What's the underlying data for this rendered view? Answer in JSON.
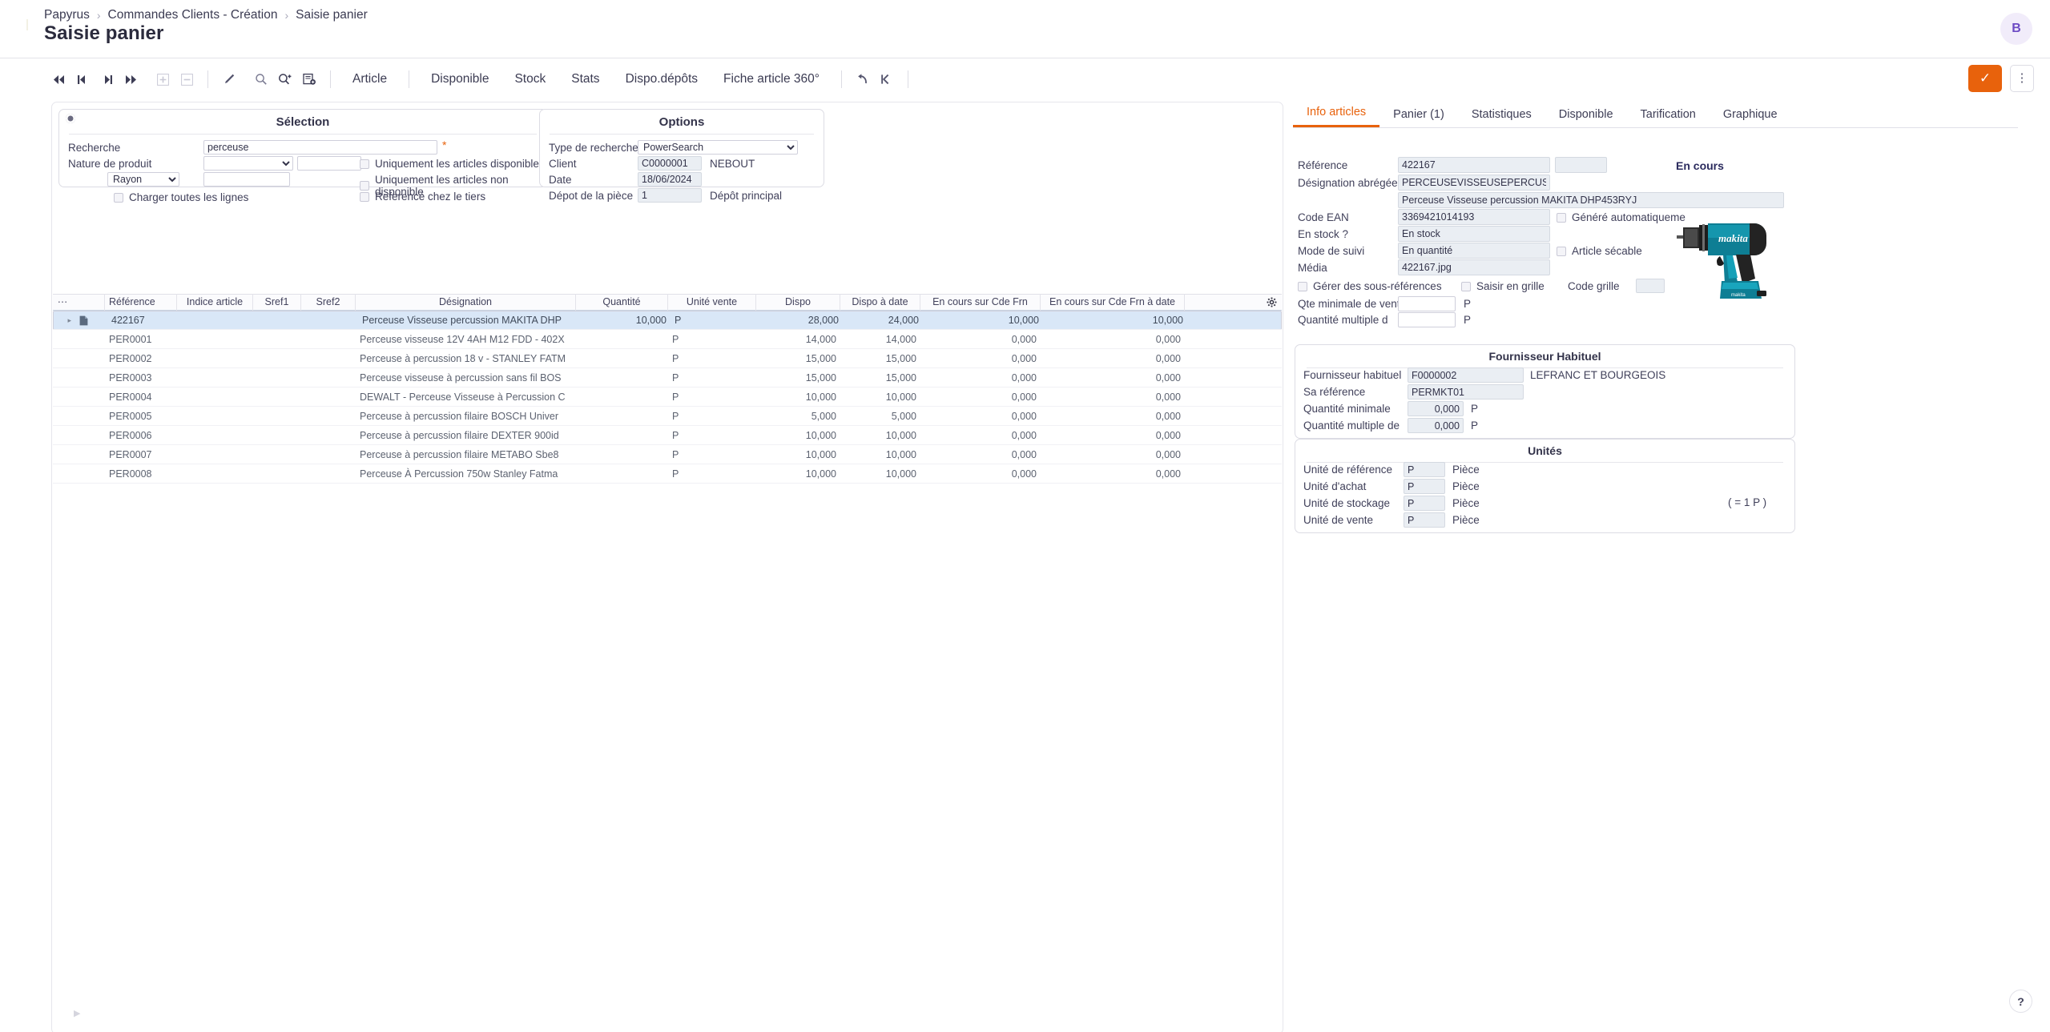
{
  "app": {
    "breadcrumb": [
      "Papyrus",
      "Commandes Clients - Création",
      "Saisie panier"
    ],
    "page_title": "Saisie panier",
    "avatar_initial": "B",
    "accent_color": "#e8620c",
    "selected_row_color": "#d9e7f7"
  },
  "toolbar": {
    "nav": [
      "first-icon",
      "prev-icon",
      "next-icon",
      "last-icon"
    ],
    "add_label": "+",
    "remove_label": "−",
    "pencil_icon": "pencil-icon",
    "search_icon": "search-icon",
    "zoom_in_icon": "zoom-in-icon",
    "card_add_icon": "card-add-icon",
    "links": [
      "Article",
      "Disponible",
      "Stock",
      "Stats",
      "Dispo.dépôts",
      "Fiche article 360°"
    ],
    "undo_icon": "undo-icon",
    "collapse_icon": "collapse-left-icon",
    "validate_label": "✓",
    "kebab_label": "⋮"
  },
  "selection": {
    "title": "Sélection",
    "recherche_label": "Recherche",
    "recherche_value": "perceuse",
    "recherche_required": "*",
    "nature_label": "Nature de produit",
    "nature_value": "",
    "nature_extra": "",
    "rayon_value": "Rayon",
    "rayon_options": [
      "Rayon"
    ],
    "rayon_text": "",
    "charger_label": "Charger toutes les lignes",
    "checks": [
      "Uniquement les articles disponibles",
      "Uniquement les articles non disponible",
      "Referencé chez le tiers"
    ]
  },
  "options": {
    "title": "Options",
    "rows": [
      {
        "label": "Type de recherche",
        "value": "PowerSearch",
        "type": "select",
        "extra": ""
      },
      {
        "label": "Client",
        "value": "C0000001",
        "type": "ro",
        "extra": "NEBOUT"
      },
      {
        "label": "Date",
        "value": "18/06/2024",
        "type": "ro",
        "extra": ""
      },
      {
        "label": "Dépot de la pièce",
        "value": "1",
        "type": "ro",
        "extra": "Dépôt principal"
      }
    ],
    "type_options": [
      "PowerSearch"
    ]
  },
  "grid": {
    "menu_icon": "grid-menu-icon",
    "gear_icon": "gear-icon",
    "columns": [
      "Référence",
      "Indice article",
      "Sref1",
      "Sref2",
      "Désignation",
      "Quantité",
      "Unité vente",
      "Dispo",
      "Dispo à date",
      "En cours sur Cde Frn",
      "En cours sur Cde Frn à date"
    ],
    "rows": [
      {
        "ref": "422167",
        "indice": "",
        "sref1": "",
        "sref2": "",
        "designation": "Perceuse Visseuse percussion MAKITA DHP",
        "quantite": "10,000",
        "unite": "P",
        "dispo": "28,000",
        "dispo_date": "24,000",
        "encours": "10,000",
        "encours_date": "10,000",
        "selected": true
      },
      {
        "ref": "PER0001",
        "indice": "",
        "sref1": "",
        "sref2": "",
        "designation": "Perceuse visseuse 12V 4AH M12 FDD - 402X",
        "quantite": "",
        "unite": "P",
        "dispo": "14,000",
        "dispo_date": "14,000",
        "encours": "0,000",
        "encours_date": "0,000",
        "selected": false
      },
      {
        "ref": "PER0002",
        "indice": "",
        "sref1": "",
        "sref2": "",
        "designation": "Perceuse à percussion 18 v - STANLEY FATM",
        "quantite": "",
        "unite": "P",
        "dispo": "15,000",
        "dispo_date": "15,000",
        "encours": "0,000",
        "encours_date": "0,000",
        "selected": false
      },
      {
        "ref": "PER0003",
        "indice": "",
        "sref1": "",
        "sref2": "",
        "designation": "Perceuse visseuse à percussion sans fil BOS",
        "quantite": "",
        "unite": "P",
        "dispo": "15,000",
        "dispo_date": "15,000",
        "encours": "0,000",
        "encours_date": "0,000",
        "selected": false
      },
      {
        "ref": "PER0004",
        "indice": "",
        "sref1": "",
        "sref2": "",
        "designation": "DEWALT - Perceuse Visseuse à Percussion C",
        "quantite": "",
        "unite": "P",
        "dispo": "10,000",
        "dispo_date": "10,000",
        "encours": "0,000",
        "encours_date": "0,000",
        "selected": false
      },
      {
        "ref": "PER0005",
        "indice": "",
        "sref1": "",
        "sref2": "",
        "designation": "Perceuse à percussion filaire BOSCH Univer",
        "quantite": "",
        "unite": "P",
        "dispo": "5,000",
        "dispo_date": "5,000",
        "encours": "0,000",
        "encours_date": "0,000",
        "selected": false
      },
      {
        "ref": "PER0006",
        "indice": "",
        "sref1": "",
        "sref2": "",
        "designation": "Perceuse à percussion filaire DEXTER 900id",
        "quantite": "",
        "unite": "P",
        "dispo": "10,000",
        "dispo_date": "10,000",
        "encours": "0,000",
        "encours_date": "0,000",
        "selected": false
      },
      {
        "ref": "PER0007",
        "indice": "",
        "sref1": "",
        "sref2": "",
        "designation": "Perceuse à percussion filaire METABO Sbe8",
        "quantite": "",
        "unite": "P",
        "dispo": "10,000",
        "dispo_date": "10,000",
        "encours": "0,000",
        "encours_date": "0,000",
        "selected": false
      },
      {
        "ref": "PER0008",
        "indice": "",
        "sref1": "",
        "sref2": "",
        "designation": "Perceuse À Percussion 750w Stanley Fatma",
        "quantite": "",
        "unite": "P",
        "dispo": "10,000",
        "dispo_date": "10,000",
        "encours": "0,000",
        "encours_date": "0,000",
        "selected": false
      }
    ]
  },
  "detail": {
    "tabs": [
      {
        "label": "Info articles",
        "active": true
      },
      {
        "label": "Panier (1)",
        "active": false
      },
      {
        "label": "Statistiques",
        "active": false
      },
      {
        "label": "Disponible",
        "active": false
      },
      {
        "label": "Tarification",
        "active": false
      },
      {
        "label": "Graphique",
        "active": false
      }
    ],
    "status": "En cours",
    "fields": {
      "reference_label": "Référence",
      "reference_value": "422167",
      "reference_extra": "",
      "designation_abregee_label": "Désignation abrégée",
      "designation_abregee_value": "PERCEUSEVISSEUSEPERCUSSIO",
      "designation_longue_value": "Perceuse Visseuse percussion MAKITA DHP453RYJ",
      "code_ean_label": "Code EAN",
      "code_ean_value": "3369421014193",
      "genere_auto_label": "Généré automatiqueme",
      "en_stock_label": "En stock ?",
      "en_stock_value": "En stock",
      "mode_suivi_label": "Mode de suivi",
      "mode_suivi_value": "En quantité",
      "article_secable_label": "Article sécable",
      "media_label": "Média",
      "media_value": "422167.jpg",
      "gerer_sous_ref_label": "Gérer des sous-références",
      "saisir_grille_label": "Saisir en grille",
      "code_grille_label": "Code grille",
      "code_grille_value": "",
      "qte_min_label": "Qte minimale de vente",
      "qte_min_value": "",
      "qte_min_unit": "P",
      "qte_mult_label": "Quantité multiple d",
      "qte_mult_value": "",
      "qte_mult_unit": "P"
    },
    "fournisseur": {
      "title": "Fournisseur Habituel",
      "rows": [
        {
          "label": "Fournisseur habituel",
          "value": "F0000002",
          "extra": "LEFRANC ET BOURGEOIS",
          "unit": ""
        },
        {
          "label": "Sa référence",
          "value": "PERMKT01",
          "extra": "",
          "unit": ""
        },
        {
          "label": "Quantité minimale",
          "value": "0,000",
          "extra": "",
          "unit": "P"
        },
        {
          "label": "Quantité multiple de",
          "value": "0,000",
          "extra": "",
          "unit": "P"
        }
      ]
    },
    "unites": {
      "title": "Unités",
      "note": "( = 1 P )",
      "rows": [
        {
          "label": "Unité de référence",
          "value": "P",
          "extra": "Pièce"
        },
        {
          "label": "Unité d'achat",
          "value": "P",
          "extra": "Pièce"
        },
        {
          "label": "Unité de stockage",
          "value": "P",
          "extra": "Pièce"
        },
        {
          "label": "Unité de vente",
          "value": "P",
          "extra": "Pièce"
        }
      ]
    },
    "product_image_alt": "makita-drill-image"
  },
  "help": {
    "label": "?"
  }
}
